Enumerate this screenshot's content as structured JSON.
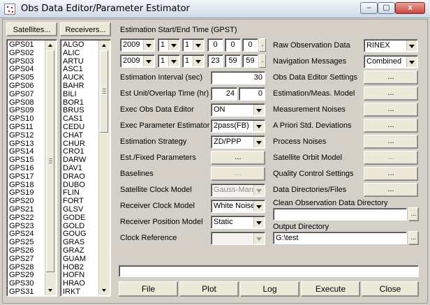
{
  "window": {
    "title": "Obs Data Editor/Parameter Estimator",
    "minimize": "–",
    "restore": "▢",
    "close": "x"
  },
  "left": {
    "satellites_button": "Satellites...",
    "receivers_button": "Receivers...",
    "satellites": [
      "GPS01",
      "GPS02",
      "GPS03",
      "GPS04",
      "GPS05",
      "GPS06",
      "GPS07",
      "GPS08",
      "GPS09",
      "GPS10",
      "GPS11",
      "GPS12",
      "GPS13",
      "GPS14",
      "GPS15",
      "GPS16",
      "GPS17",
      "GPS18",
      "GPS19",
      "GPS20",
      "GPS21",
      "GPS22",
      "GPS23",
      "GPS24",
      "GPS25",
      "GPS26",
      "GPS27",
      "GPS28",
      "GPS29",
      "GPS30",
      "GPS31"
    ],
    "receivers": [
      "ALGO",
      "ALIC",
      "ARTU",
      "ASC1",
      "AUCK",
      "BAHR",
      "BILI",
      "BOR1",
      "BRUS",
      "CAS1",
      "CEDU",
      "CHAT",
      "CHUR",
      "CRO1",
      "DARW",
      "DAV1",
      "DRAO",
      "DUBO",
      "FLIN",
      "FORT",
      "GLSV",
      "GODE",
      "GOLD",
      "GOUG",
      "GRAS",
      "GRAZ",
      "GUAM",
      "HOB2",
      "HOFN",
      "HRAO",
      "IRKT"
    ]
  },
  "time": {
    "label": "Estimation Start/End Time (GPST)",
    "start": {
      "year": "2009",
      "month": "1",
      "day": "1",
      "hour": "0",
      "min": "0",
      "sec": "0"
    },
    "end": {
      "year": "2009",
      "month": "1",
      "day": "1",
      "hour": "23",
      "min": "59",
      "sec": "59"
    },
    "dot": "."
  },
  "params": {
    "interval_label": "Estimation Interval (sec)",
    "interval_value": "30",
    "unit_overlap_label": "Est Unit/Overlap Time (hr)",
    "unit_value": "24",
    "overlap_value": "0",
    "exec_obs_label": "Exec Obs Data Editor",
    "exec_obs_value": "ON",
    "exec_param_label": "Exec Parameter Estimator",
    "exec_param_value": "2pass(FB)",
    "strategy_label": "Estimation Strategy",
    "strategy_value": "ZD/PPP",
    "est_fixed_label": "Est./Fixed Parameters",
    "est_fixed_btn": "...",
    "baselines_label": "Baselines",
    "baselines_btn": "...",
    "sat_clock_label": "Satellite Clock Model",
    "sat_clock_value": "Gauss-Marc",
    "rcv_clock_label": "Receiver Clock Model",
    "rcv_clock_value": "White Noise",
    "rcv_pos_label": "Receiver Position Model",
    "rcv_pos_value": "Static",
    "clock_ref_label": "Clock Reference",
    "clock_ref_value": ""
  },
  "right": {
    "raw_obs_label": "Raw Observation Data",
    "raw_obs_value": "RINEX",
    "nav_label": "Navigation Messages",
    "nav_value": "Combined",
    "obs_settings_label": "Obs Data Editor Settings",
    "est_model_label": "Estimation/Meas. Model",
    "meas_noise_label": "Measurement Noises",
    "apriori_label": "A Priori Std. Deviations",
    "process_noise_label": "Process Noises",
    "sat_orbit_label": "Satellite Orbit Model",
    "qc_label": "Quality Control Settings",
    "data_dirs_label": "Data Directories/Files",
    "ellipsis": "...",
    "clean_dir_label": "Clean Observation Data Directory",
    "clean_dir_value": "",
    "output_dir_label": "Output Directory",
    "output_dir_value": "G:\\test"
  },
  "status": {
    "message": ""
  },
  "bottom": {
    "file": "File",
    "plot": "Plot",
    "log": "Log",
    "execute": "Execute",
    "close": "Close"
  }
}
